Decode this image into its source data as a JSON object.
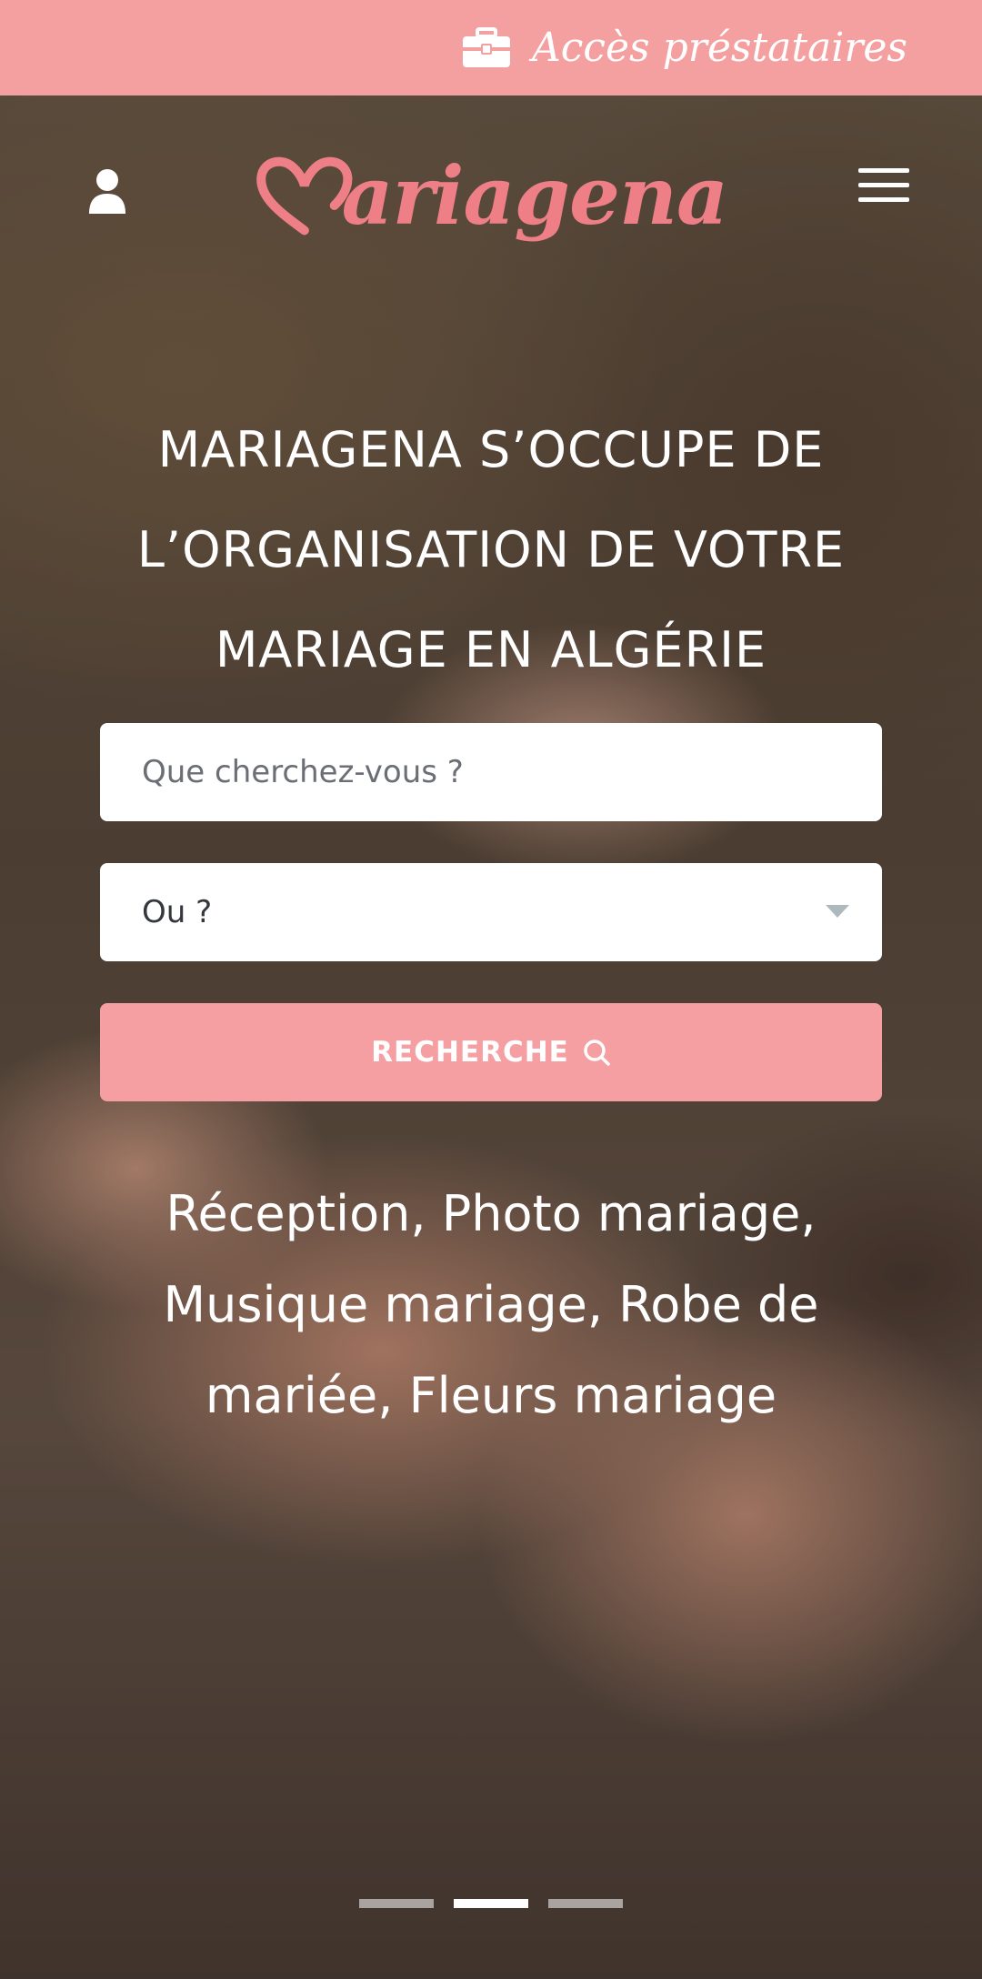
{
  "topbar": {
    "provider_access_label": "Accès préstataires",
    "icon": "briefcase-icon"
  },
  "header": {
    "logo_text": "ariagena",
    "logo_icon": "heart-m-icon",
    "user_icon": "user-icon",
    "menu_icon": "hamburger-menu-icon"
  },
  "hero": {
    "headline_lines": [
      "MARIAGENA S’OCCUPE DE",
      "L’ORGANISATION DE VOTRE",
      "MARIAGE EN ALGÉRIE"
    ],
    "search": {
      "placeholder": "Que cherchez-vous ?",
      "location_value": "Ou ?",
      "button_label": "RECHERCHE"
    },
    "categories_lines": [
      "Réception, Photo mariage,",
      "Musique mariage, Robe de",
      "mariée, Fleurs mariage"
    ],
    "carousel": {
      "slide_count": 3,
      "active_index": 1
    }
  },
  "colors": {
    "brand_pink": "#f4a0a1",
    "logo_pink": "#ef7f86",
    "white": "#ffffff"
  }
}
